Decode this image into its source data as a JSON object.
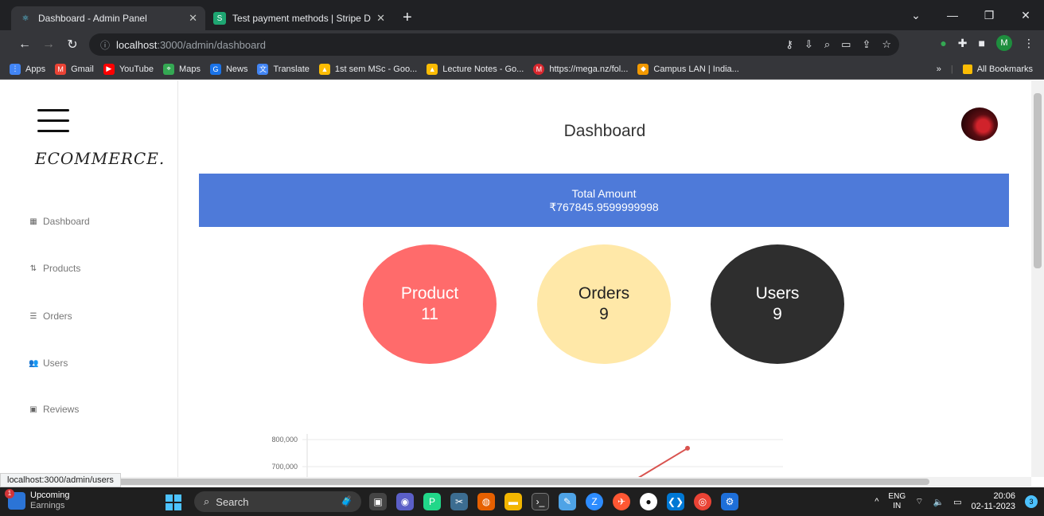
{
  "browser": {
    "tabs": [
      {
        "title": "Dashboard - Admin Panel",
        "favicon": "react-icon"
      },
      {
        "title": "Test payment methods | Stripe D",
        "favicon": "stripe-icon"
      }
    ],
    "address": {
      "host": "localhost",
      "path": ":3000/admin/dashboard"
    },
    "profile_initial": "M",
    "bookmarks": [
      {
        "label": "Apps",
        "color": "#4285f4"
      },
      {
        "label": "Gmail",
        "color": "#ea4335"
      },
      {
        "label": "YouTube",
        "color": "#ff0000"
      },
      {
        "label": "Maps",
        "color": "#34a853"
      },
      {
        "label": "News",
        "color": "#1a73e8"
      },
      {
        "label": "Translate",
        "color": "#4285f4"
      },
      {
        "label": "1st sem MSc - Goo...",
        "color": "#fbbc04"
      },
      {
        "label": "Lecture Notes - Go...",
        "color": "#fbbc04"
      },
      {
        "label": "https://mega.nz/fol...",
        "color": "#d9272e"
      },
      {
        "label": "Campus LAN | India...",
        "color": "#f29900"
      }
    ],
    "all_bookmarks": "All Bookmarks",
    "status_url": "localhost:3000/admin/users"
  },
  "sidebar": {
    "brand": "ECOMMERCE.",
    "items": [
      {
        "label": "Dashboard",
        "icon": "grid-icon"
      },
      {
        "label": "Products",
        "icon": "products-icon"
      },
      {
        "label": "Orders",
        "icon": "list-icon"
      },
      {
        "label": "Users",
        "icon": "users-icon"
      },
      {
        "label": "Reviews",
        "icon": "reviews-icon"
      }
    ]
  },
  "main": {
    "title": "Dashboard",
    "total_label": "Total Amount",
    "total_value": "₹767845.9599999998",
    "stats": [
      {
        "label": "Product",
        "value": "11",
        "color": "#ff6b6b"
      },
      {
        "label": "Orders",
        "value": "9",
        "color": "#ffe8a8"
      },
      {
        "label": "Users",
        "value": "9",
        "color": "#2e2e2e"
      }
    ]
  },
  "chart_data": {
    "type": "line",
    "y_ticks": [
      "800,000",
      "700,000"
    ],
    "series": [
      {
        "line_color": "#d9534f"
      }
    ],
    "ylim_visible": [
      700000,
      800000
    ],
    "last_point_value": 767845.96
  },
  "taskbar": {
    "weather_title": "Upcoming",
    "weather_sub": "Earnings",
    "weather_badge": "1",
    "search_placeholder": "Search",
    "lang_top": "ENG",
    "lang_bottom": "IN",
    "time": "20:06",
    "date": "02-11-2023",
    "notifications": "3"
  }
}
